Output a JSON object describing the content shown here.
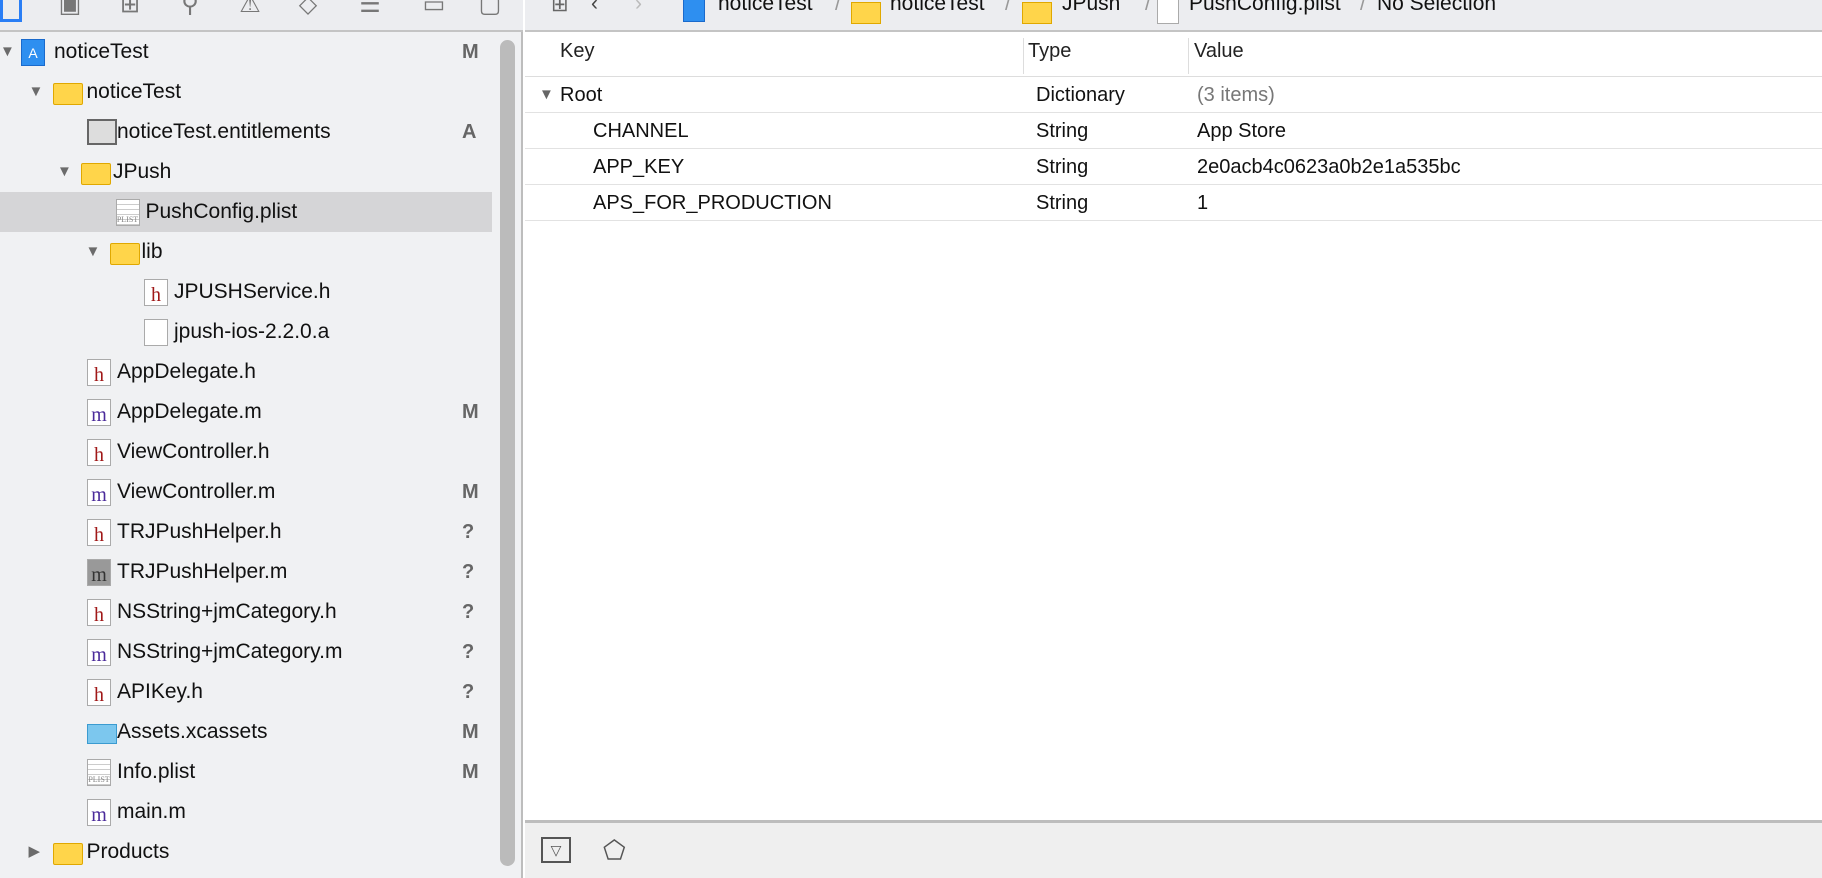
{
  "navigator_toolbar": {
    "icons": [
      "project-navigator-icon",
      "symbol-navigator-icon",
      "hierarchy-icon",
      "search-icon",
      "warning-icon",
      "test-icon",
      "debug-icon",
      "breakpoint-icon",
      "report-icon"
    ]
  },
  "tree": [
    {
      "label": "noticeTest",
      "depth": 0,
      "kind": "project",
      "disclosure": "open",
      "status": "M"
    },
    {
      "label": "noticeTest",
      "depth": 1,
      "kind": "folder",
      "disclosure": "open",
      "status": ""
    },
    {
      "label": "noticeTest.entitlements",
      "depth": 2,
      "kind": "entitlements",
      "status": "A"
    },
    {
      "label": "JPush",
      "depth": 2,
      "kind": "folder",
      "disclosure": "open",
      "status": ""
    },
    {
      "label": "PushConfig.plist",
      "depth": 3,
      "kind": "plist",
      "status": "",
      "selected": true
    },
    {
      "label": "lib",
      "depth": 3,
      "kind": "folder",
      "disclosure": "open",
      "status": ""
    },
    {
      "label": "JPUSHService.h",
      "depth": 4,
      "kind": "h",
      "status": ""
    },
    {
      "label": "jpush-ios-2.2.0.a",
      "depth": 4,
      "kind": "blank",
      "status": ""
    },
    {
      "label": "AppDelegate.h",
      "depth": 2,
      "kind": "h",
      "status": ""
    },
    {
      "label": "AppDelegate.m",
      "depth": 2,
      "kind": "m",
      "status": "M"
    },
    {
      "label": "ViewController.h",
      "depth": 2,
      "kind": "h",
      "status": ""
    },
    {
      "label": "ViewController.m",
      "depth": 2,
      "kind": "m",
      "status": "M"
    },
    {
      "label": "TRJPushHelper.h",
      "depth": 2,
      "kind": "h",
      "status": "?"
    },
    {
      "label": "TRJPushHelper.m",
      "depth": 2,
      "kind": "mg",
      "status": "?"
    },
    {
      "label": "NSString+jmCategory.h",
      "depth": 2,
      "kind": "h",
      "status": "?"
    },
    {
      "label": "NSString+jmCategory.m",
      "depth": 2,
      "kind": "m",
      "status": "?"
    },
    {
      "label": "APIKey.h",
      "depth": 2,
      "kind": "h",
      "status": "?"
    },
    {
      "label": "Assets.xcassets",
      "depth": 2,
      "kind": "xcassets",
      "status": "M"
    },
    {
      "label": "Info.plist",
      "depth": 2,
      "kind": "plist",
      "status": "M"
    },
    {
      "label": "main.m",
      "depth": 2,
      "kind": "m",
      "status": ""
    },
    {
      "label": "Products",
      "depth": 1,
      "kind": "folder",
      "disclosure": "closed",
      "status": ""
    }
  ],
  "jumpbar": {
    "path": [
      "noticeTest",
      "noticeTest",
      "JPush",
      "PushConfig.plist"
    ],
    "selection": "No Selection"
  },
  "plist": {
    "headers": {
      "key": "Key",
      "type": "Type",
      "value": "Value"
    },
    "rows": [
      {
        "key": "Root",
        "type": "Dictionary",
        "value": "(3 items)",
        "root": true
      },
      {
        "key": "CHANNEL",
        "type": "String",
        "value": "App Store"
      },
      {
        "key": "APP_KEY",
        "type": "String",
        "value": "2e0acb4c0623a0b2e1a535bc"
      },
      {
        "key": "APS_FOR_PRODUCTION",
        "type": "String",
        "value": "1"
      }
    ]
  },
  "bottom_bar": {
    "icons": [
      "filter-icon",
      "tag-icon"
    ]
  }
}
